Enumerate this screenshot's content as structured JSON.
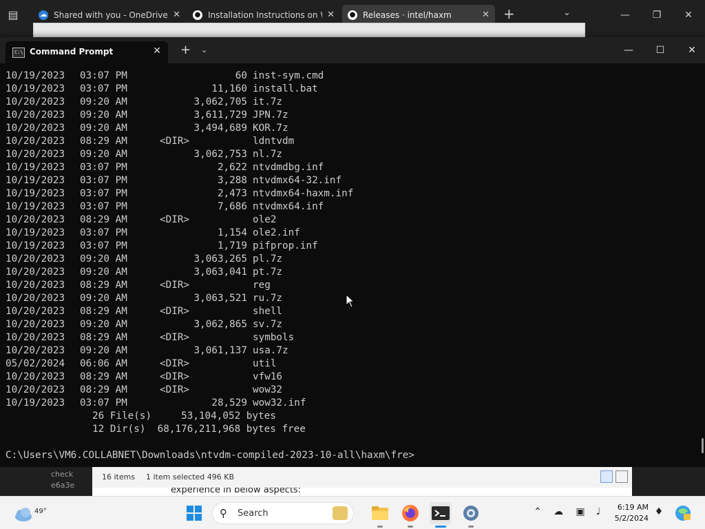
{
  "browser": {
    "tabs": [
      {
        "label": "Shared with you - OneDrive",
        "icon": "onedrive-icon",
        "active": false
      },
      {
        "label": "Installation Instructions on Win",
        "icon": "github-icon",
        "active": false
      },
      {
        "label": "Releases · intel/haxm",
        "icon": "github-icon",
        "active": true
      }
    ]
  },
  "terminal": {
    "tab_title": "Command Prompt",
    "icon_glyph": "C:\\",
    "listing": [
      {
        "date": "10/19/2023",
        "time": "03:07 PM",
        "size": "60",
        "name": "inst-sym.cmd"
      },
      {
        "date": "10/19/2023",
        "time": "03:07 PM",
        "size": "11,160",
        "name": "install.bat"
      },
      {
        "date": "10/20/2023",
        "time": "09:20 AM",
        "size": "3,062,705",
        "name": "it.7z"
      },
      {
        "date": "10/20/2023",
        "time": "09:20 AM",
        "size": "3,611,729",
        "name": "JPN.7z"
      },
      {
        "date": "10/20/2023",
        "time": "09:20 AM",
        "size": "3,494,689",
        "name": "KOR.7z"
      },
      {
        "date": "10/20/2023",
        "time": "08:29 AM",
        "size": "<DIR>",
        "name": "ldntvdm"
      },
      {
        "date": "10/20/2023",
        "time": "09:20 AM",
        "size": "3,062,753",
        "name": "nl.7z"
      },
      {
        "date": "10/19/2023",
        "time": "03:07 PM",
        "size": "2,622",
        "name": "ntvdmdbg.inf"
      },
      {
        "date": "10/19/2023",
        "time": "03:07 PM",
        "size": "3,288",
        "name": "ntvdmx64-32.inf"
      },
      {
        "date": "10/19/2023",
        "time": "03:07 PM",
        "size": "2,473",
        "name": "ntvdmx64-haxm.inf"
      },
      {
        "date": "10/19/2023",
        "time": "03:07 PM",
        "size": "7,686",
        "name": "ntvdmx64.inf"
      },
      {
        "date": "10/20/2023",
        "time": "08:29 AM",
        "size": "<DIR>",
        "name": "ole2"
      },
      {
        "date": "10/19/2023",
        "time": "03:07 PM",
        "size": "1,154",
        "name": "ole2.inf"
      },
      {
        "date": "10/19/2023",
        "time": "03:07 PM",
        "size": "1,719",
        "name": "pifprop.inf"
      },
      {
        "date": "10/20/2023",
        "time": "09:20 AM",
        "size": "3,063,265",
        "name": "pl.7z"
      },
      {
        "date": "10/20/2023",
        "time": "09:20 AM",
        "size": "3,063,041",
        "name": "pt.7z"
      },
      {
        "date": "10/20/2023",
        "time": "08:29 AM",
        "size": "<DIR>",
        "name": "reg"
      },
      {
        "date": "10/20/2023",
        "time": "09:20 AM",
        "size": "3,063,521",
        "name": "ru.7z"
      },
      {
        "date": "10/20/2023",
        "time": "08:29 AM",
        "size": "<DIR>",
        "name": "shell"
      },
      {
        "date": "10/20/2023",
        "time": "09:20 AM",
        "size": "3,062,865",
        "name": "sv.7z"
      },
      {
        "date": "10/20/2023",
        "time": "08:29 AM",
        "size": "<DIR>",
        "name": "symbols"
      },
      {
        "date": "10/20/2023",
        "time": "09:20 AM",
        "size": "3,061,137",
        "name": "usa.7z"
      },
      {
        "date": "05/02/2024",
        "time": "06:06 AM",
        "size": "<DIR>",
        "name": "util"
      },
      {
        "date": "10/20/2023",
        "time": "08:29 AM",
        "size": "<DIR>",
        "name": "vfw16"
      },
      {
        "date": "10/20/2023",
        "time": "08:29 AM",
        "size": "<DIR>",
        "name": "wow32"
      },
      {
        "date": "10/19/2023",
        "time": "03:07 PM",
        "size": "28,529",
        "name": "wow32.inf"
      }
    ],
    "summary_files": "26 File(s)     53,104,052 bytes",
    "summary_dirs": "12 Dir(s)  68,176,211,968 bytes free",
    "prompt": "C:\\Users\\VM6.COLLABNET\\Downloads\\ntvdm-compiled-2023-10-all\\haxm\\fre>"
  },
  "explorer": {
    "left_label_1": "check",
    "left_label_2": "e6a3e",
    "item_count": "16 items",
    "selection": "1 item selected  496 KB",
    "behind_text": "experience in below aspects:"
  },
  "taskbar": {
    "temperature": "49°",
    "search_label": "Search",
    "clock_time": "6:19 AM",
    "clock_date": "5/2/2024"
  },
  "colors": {
    "terminal_bg": "#0c0c0c",
    "terminal_text": "#cccccc",
    "taskbar_bg": "#f3f3f3",
    "accent": "#1f8be0"
  }
}
